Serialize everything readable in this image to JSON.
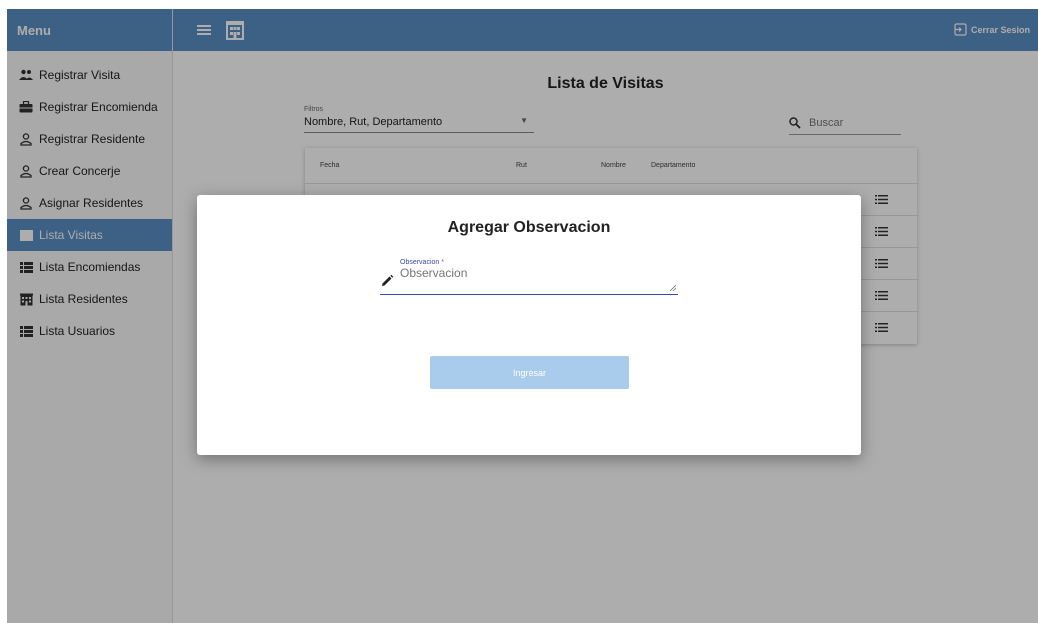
{
  "sidebar": {
    "title": "Menu",
    "items": [
      {
        "label": "Registrar Visita",
        "icon": "people-icon",
        "active": false
      },
      {
        "label": "Registrar Encomienda",
        "icon": "briefcase-icon",
        "active": false
      },
      {
        "label": "Registrar Residente",
        "icon": "person-icon",
        "active": false
      },
      {
        "label": "Crear Concerje",
        "icon": "person-icon",
        "active": false
      },
      {
        "label": "Asignar Residentes",
        "icon": "person-icon",
        "active": false
      },
      {
        "label": "Lista Visitas",
        "icon": "list-icon",
        "active": true
      },
      {
        "label": "Lista Encomiendas",
        "icon": "list-icon",
        "active": false
      },
      {
        "label": "Lista Residentes",
        "icon": "building-icon",
        "active": false
      },
      {
        "label": "Lista Usuarios",
        "icon": "list-icon",
        "active": false
      }
    ]
  },
  "topbar": {
    "logout_label": "Cerrar Sesion"
  },
  "main": {
    "title": "Lista de Visitas",
    "filter": {
      "label": "Filtros",
      "value": "Nombre, Rut, Departamento"
    },
    "search": {
      "placeholder": "Buscar"
    },
    "table": {
      "columns": [
        "Fecha",
        "Rut",
        "Nombre",
        "Departamento"
      ],
      "row_count": 5
    }
  },
  "modal": {
    "title": "Agregar Observacion",
    "field_label": "Observacion",
    "field_required_mark": "*",
    "field_placeholder": "Observacion",
    "submit_label": "Ingresar"
  },
  "colors": {
    "primary": "#5b8ec5",
    "button_disabled": "#a9cbec",
    "input_accent": "#3949ab"
  }
}
